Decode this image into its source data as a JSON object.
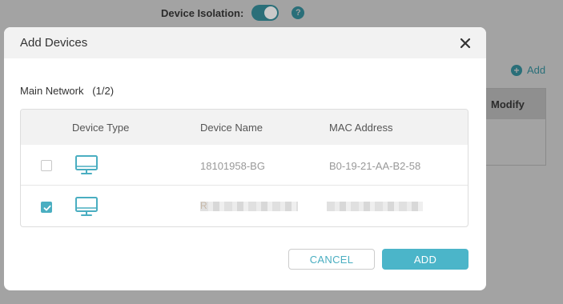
{
  "background": {
    "isolation_label": "Device Isolation:",
    "help_icon": "?",
    "add_label": "Add",
    "modify_label": "Modify"
  },
  "modal": {
    "title": "Add Devices",
    "section_label": "Main Network   (1/2)",
    "columns": [
      "Device Type",
      "Device Name",
      "MAC Address"
    ],
    "rows": [
      {
        "checked": false,
        "icon": "monitor-icon",
        "name": "18101958-BG",
        "mac": "B0-19-21-AA-B2-58"
      },
      {
        "checked": true,
        "icon": "monitor-icon",
        "name": "R",
        "mac": ""
      }
    ],
    "cancel_label": "CANCEL",
    "add_label": "ADD"
  },
  "colors": {
    "accent": "#4bb5c9",
    "accent_dark": "#2a6f79"
  }
}
